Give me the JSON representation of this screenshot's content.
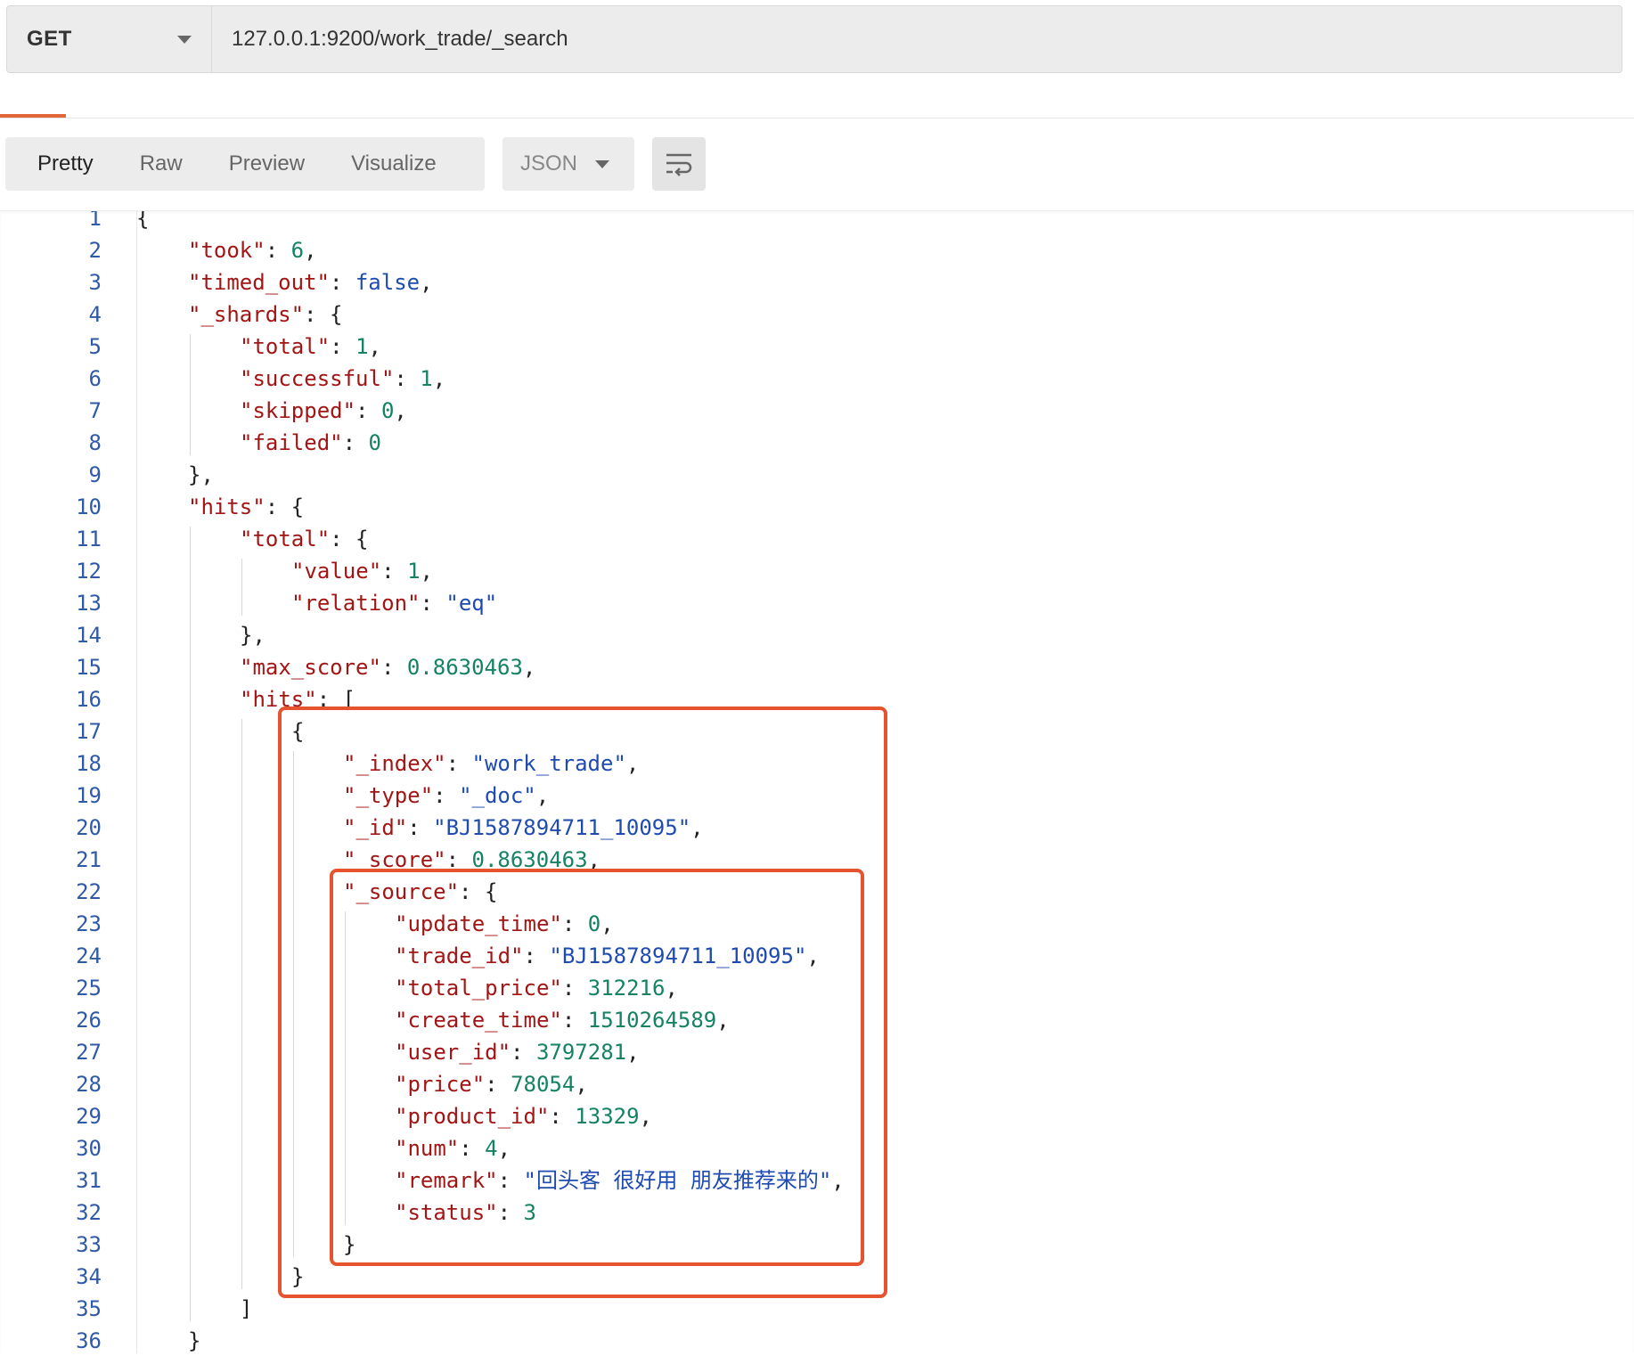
{
  "request": {
    "method": "GET",
    "url": "127.0.0.1:9200/work_trade/_search"
  },
  "response_toolbar": {
    "tabs": [
      "Pretty",
      "Raw",
      "Preview",
      "Visualize"
    ],
    "active_tab": "Pretty",
    "format": "JSON"
  },
  "colors": {
    "accent": "#e2683a",
    "highlight_border": "#e6532f",
    "json_key": "#a31515",
    "json_string": "#1f4bb0",
    "json_number": "#148263",
    "json_boolean": "#1f4bb0",
    "line_number": "#2f5aa8"
  },
  "response_lines": [
    {
      "n": "1",
      "indent": 0,
      "parts": [
        [
          "p",
          "{"
        ]
      ]
    },
    {
      "n": "2",
      "indent": 1,
      "parts": [
        [
          "k",
          "\"took\""
        ],
        [
          "p",
          ": "
        ],
        [
          "n",
          "6"
        ],
        [
          "p",
          ","
        ]
      ]
    },
    {
      "n": "3",
      "indent": 1,
      "parts": [
        [
          "k",
          "\"timed_out\""
        ],
        [
          "p",
          ": "
        ],
        [
          "b",
          "false"
        ],
        [
          "p",
          ","
        ]
      ]
    },
    {
      "n": "4",
      "indent": 1,
      "parts": [
        [
          "k",
          "\"_shards\""
        ],
        [
          "p",
          ": {"
        ]
      ]
    },
    {
      "n": "5",
      "indent": 2,
      "parts": [
        [
          "k",
          "\"total\""
        ],
        [
          "p",
          ": "
        ],
        [
          "n",
          "1"
        ],
        [
          "p",
          ","
        ]
      ]
    },
    {
      "n": "6",
      "indent": 2,
      "parts": [
        [
          "k",
          "\"successful\""
        ],
        [
          "p",
          ": "
        ],
        [
          "n",
          "1"
        ],
        [
          "p",
          ","
        ]
      ]
    },
    {
      "n": "7",
      "indent": 2,
      "parts": [
        [
          "k",
          "\"skipped\""
        ],
        [
          "p",
          ": "
        ],
        [
          "n",
          "0"
        ],
        [
          "p",
          ","
        ]
      ]
    },
    {
      "n": "8",
      "indent": 2,
      "parts": [
        [
          "k",
          "\"failed\""
        ],
        [
          "p",
          ": "
        ],
        [
          "n",
          "0"
        ]
      ]
    },
    {
      "n": "9",
      "indent": 1,
      "parts": [
        [
          "p",
          "},"
        ]
      ]
    },
    {
      "n": "10",
      "indent": 1,
      "parts": [
        [
          "k",
          "\"hits\""
        ],
        [
          "p",
          ": {"
        ]
      ]
    },
    {
      "n": "11",
      "indent": 2,
      "parts": [
        [
          "k",
          "\"total\""
        ],
        [
          "p",
          ": {"
        ]
      ]
    },
    {
      "n": "12",
      "indent": 3,
      "parts": [
        [
          "k",
          "\"value\""
        ],
        [
          "p",
          ": "
        ],
        [
          "n",
          "1"
        ],
        [
          "p",
          ","
        ]
      ]
    },
    {
      "n": "13",
      "indent": 3,
      "parts": [
        [
          "k",
          "\"relation\""
        ],
        [
          "p",
          ": "
        ],
        [
          "s",
          "\"eq\""
        ]
      ]
    },
    {
      "n": "14",
      "indent": 2,
      "parts": [
        [
          "p",
          "},"
        ]
      ]
    },
    {
      "n": "15",
      "indent": 2,
      "parts": [
        [
          "k",
          "\"max_score\""
        ],
        [
          "p",
          ": "
        ],
        [
          "n",
          "0.8630463"
        ],
        [
          "p",
          ","
        ]
      ]
    },
    {
      "n": "16",
      "indent": 2,
      "parts": [
        [
          "k",
          "\"hits\""
        ],
        [
          "p",
          ": ["
        ]
      ]
    },
    {
      "n": "17",
      "indent": 3,
      "parts": [
        [
          "p",
          "{"
        ]
      ]
    },
    {
      "n": "18",
      "indent": 4,
      "parts": [
        [
          "k",
          "\"_index\""
        ],
        [
          "p",
          ": "
        ],
        [
          "s",
          "\"work_trade\""
        ],
        [
          "p",
          ","
        ]
      ]
    },
    {
      "n": "19",
      "indent": 4,
      "parts": [
        [
          "k",
          "\"_type\""
        ],
        [
          "p",
          ": "
        ],
        [
          "s",
          "\"_doc\""
        ],
        [
          "p",
          ","
        ]
      ]
    },
    {
      "n": "20",
      "indent": 4,
      "parts": [
        [
          "k",
          "\"_id\""
        ],
        [
          "p",
          ": "
        ],
        [
          "s",
          "\"BJ1587894711_10095\""
        ],
        [
          "p",
          ","
        ]
      ]
    },
    {
      "n": "21",
      "indent": 4,
      "parts": [
        [
          "k",
          "\"_score\""
        ],
        [
          "p",
          ": "
        ],
        [
          "n",
          "0.8630463"
        ],
        [
          "p",
          ","
        ]
      ]
    },
    {
      "n": "22",
      "indent": 4,
      "parts": [
        [
          "k",
          "\"_source\""
        ],
        [
          "p",
          ": {"
        ]
      ]
    },
    {
      "n": "23",
      "indent": 5,
      "parts": [
        [
          "k",
          "\"update_time\""
        ],
        [
          "p",
          ": "
        ],
        [
          "n",
          "0"
        ],
        [
          "p",
          ","
        ]
      ]
    },
    {
      "n": "24",
      "indent": 5,
      "parts": [
        [
          "k",
          "\"trade_id\""
        ],
        [
          "p",
          ": "
        ],
        [
          "s",
          "\"BJ1587894711_10095\""
        ],
        [
          "p",
          ","
        ]
      ]
    },
    {
      "n": "25",
      "indent": 5,
      "parts": [
        [
          "k",
          "\"total_price\""
        ],
        [
          "p",
          ": "
        ],
        [
          "n",
          "312216"
        ],
        [
          "p",
          ","
        ]
      ]
    },
    {
      "n": "26",
      "indent": 5,
      "parts": [
        [
          "k",
          "\"create_time\""
        ],
        [
          "p",
          ": "
        ],
        [
          "n",
          "1510264589"
        ],
        [
          "p",
          ","
        ]
      ]
    },
    {
      "n": "27",
      "indent": 5,
      "parts": [
        [
          "k",
          "\"user_id\""
        ],
        [
          "p",
          ": "
        ],
        [
          "n",
          "3797281"
        ],
        [
          "p",
          ","
        ]
      ]
    },
    {
      "n": "28",
      "indent": 5,
      "parts": [
        [
          "k",
          "\"price\""
        ],
        [
          "p",
          ": "
        ],
        [
          "n",
          "78054"
        ],
        [
          "p",
          ","
        ]
      ]
    },
    {
      "n": "29",
      "indent": 5,
      "parts": [
        [
          "k",
          "\"product_id\""
        ],
        [
          "p",
          ": "
        ],
        [
          "n",
          "13329"
        ],
        [
          "p",
          ","
        ]
      ]
    },
    {
      "n": "30",
      "indent": 5,
      "parts": [
        [
          "k",
          "\"num\""
        ],
        [
          "p",
          ": "
        ],
        [
          "n",
          "4"
        ],
        [
          "p",
          ","
        ]
      ]
    },
    {
      "n": "31",
      "indent": 5,
      "parts": [
        [
          "k",
          "\"remark\""
        ],
        [
          "p",
          ": "
        ],
        [
          "s",
          "\"回头客 很好用 朋友推荐来的\""
        ],
        [
          "p",
          ","
        ]
      ]
    },
    {
      "n": "32",
      "indent": 5,
      "parts": [
        [
          "k",
          "\"status\""
        ],
        [
          "p",
          ": "
        ],
        [
          "n",
          "3"
        ]
      ]
    },
    {
      "n": "33",
      "indent": 4,
      "parts": [
        [
          "p",
          "}"
        ]
      ]
    },
    {
      "n": "34",
      "indent": 3,
      "parts": [
        [
          "p",
          "}"
        ]
      ]
    },
    {
      "n": "35",
      "indent": 2,
      "parts": [
        [
          "p",
          "]"
        ]
      ]
    },
    {
      "n": "36",
      "indent": 1,
      "parts": [
        [
          "p",
          "}"
        ]
      ]
    }
  ]
}
